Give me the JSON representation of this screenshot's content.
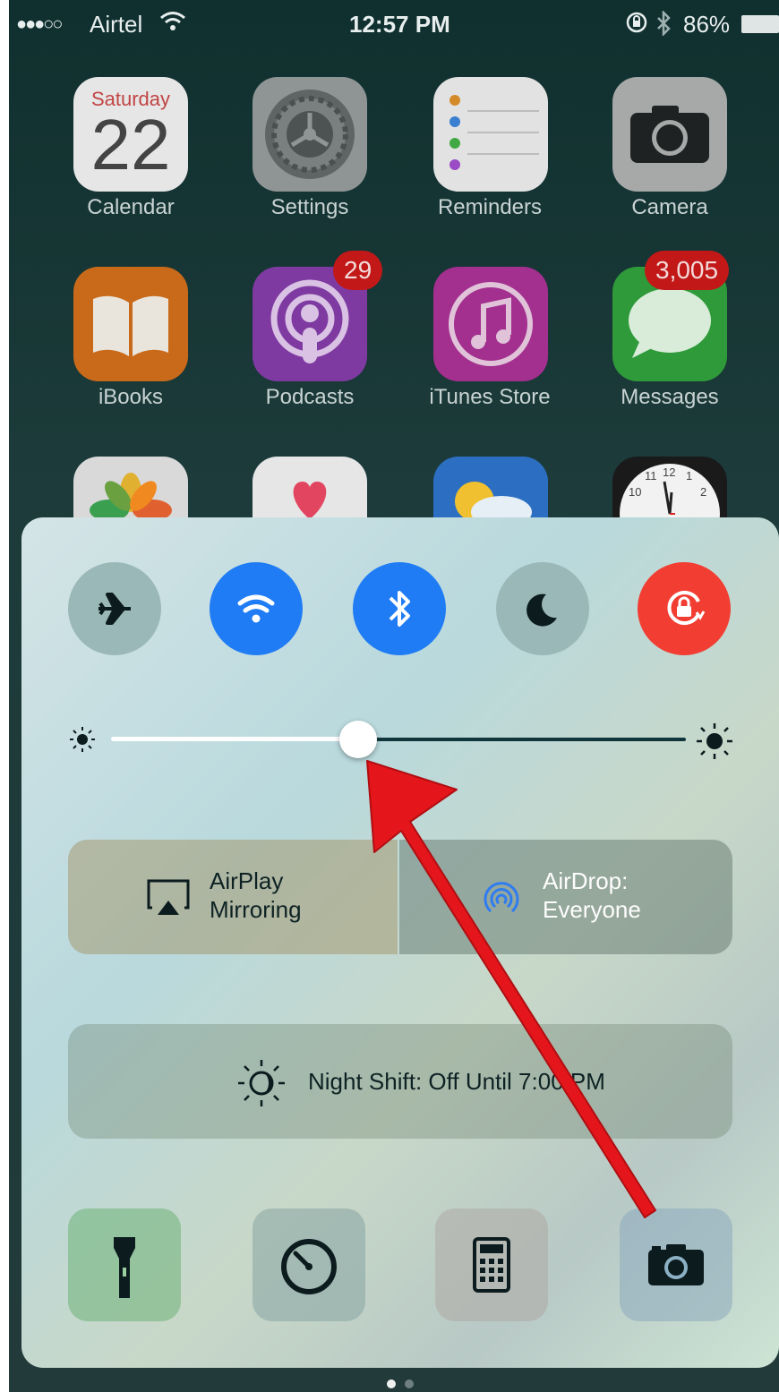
{
  "status_bar": {
    "signal": "●●●○○",
    "carrier": "Airtel",
    "time": "12:57 PM",
    "battery": "86%"
  },
  "home_apps": [
    {
      "label": "Calendar",
      "day": "Saturday",
      "date": "22"
    },
    {
      "label": "Settings"
    },
    {
      "label": "Reminders"
    },
    {
      "label": "Camera"
    },
    {
      "label": "iBooks"
    },
    {
      "label": "Podcasts",
      "badge": "29"
    },
    {
      "label": "iTunes Store"
    },
    {
      "label": "Messages",
      "badge": "3,005"
    }
  ],
  "clock_numbers": [
    "11",
    "12",
    "1",
    "10",
    "2"
  ],
  "control_center": {
    "toggles": [
      {
        "name": "airplane-mode",
        "icon": "airplane-icon",
        "state": "off"
      },
      {
        "name": "wifi",
        "icon": "wifi-icon",
        "state": "on",
        "color": "#1f7cf4"
      },
      {
        "name": "bluetooth",
        "icon": "bluetooth-icon",
        "state": "on",
        "color": "#1f7cf4"
      },
      {
        "name": "do-not-disturb",
        "icon": "moon-icon",
        "state": "off"
      },
      {
        "name": "rotation-lock",
        "icon": "rotation-lock-icon",
        "state": "on",
        "color": "#f23d32"
      }
    ],
    "brightness": {
      "level": 0.43
    },
    "airplay": {
      "line1": "AirPlay",
      "line2": "Mirroring"
    },
    "airdrop": {
      "line1": "AirDrop:",
      "line2": "Everyone"
    },
    "night_shift": {
      "label": "Night Shift: Off Until 7:00 PM"
    },
    "utilities": [
      "flashlight-icon",
      "timer-icon",
      "calculator-icon",
      "camera-icon"
    ]
  },
  "annotation": {
    "color": "#e4161b"
  },
  "page_indicator": {
    "pages": 2,
    "current": 1
  }
}
